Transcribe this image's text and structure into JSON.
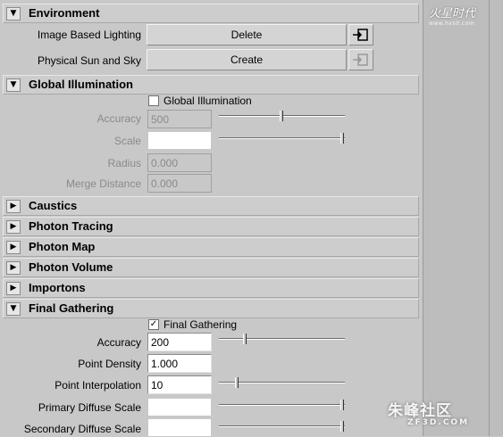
{
  "environment": {
    "title": "Environment",
    "rows": [
      {
        "label": "Image Based Lighting",
        "button": "Delete",
        "icon": "connect-icon"
      },
      {
        "label": "Physical Sun and Sky",
        "button": "Create",
        "icon": "connect-icon-disabled"
      }
    ]
  },
  "global_illumination": {
    "title": "Global Illumination",
    "checkbox_label": "Global Illumination",
    "checked": false,
    "fields": [
      {
        "label": "Accuracy",
        "value": "500",
        "slider": 0.5
      },
      {
        "label": "Scale",
        "value": "",
        "slider": 1.0
      },
      {
        "label": "Radius",
        "value": "0.000"
      },
      {
        "label": "Merge Distance",
        "value": "0.000"
      }
    ]
  },
  "collapsed_sections": [
    "Caustics",
    "Photon Tracing",
    "Photon Map",
    "Photon Volume",
    "Importons"
  ],
  "final_gathering": {
    "title": "Final Gathering",
    "checkbox_label": "Final Gathering",
    "checked": true,
    "check_mark": "✓",
    "fields": [
      {
        "label": "Accuracy",
        "value": "200",
        "slider": 0.2
      },
      {
        "label": "Point Density",
        "value": "1.000"
      },
      {
        "label": "Point Interpolation",
        "value": "10",
        "slider": 0.13
      },
      {
        "label": "Primary Diffuse Scale",
        "value": "",
        "slider": 1.0
      },
      {
        "label": "Secondary Diffuse Scale",
        "value": "",
        "slider": 1.0
      }
    ]
  },
  "arrows": {
    "expanded": "▼",
    "collapsed": "▶"
  },
  "branding": {
    "logo": "火星时代",
    "logo_sub": "www.hxsd.com",
    "watermark": "朱峰社区",
    "watermark_sub": "ZF3D.COM"
  }
}
